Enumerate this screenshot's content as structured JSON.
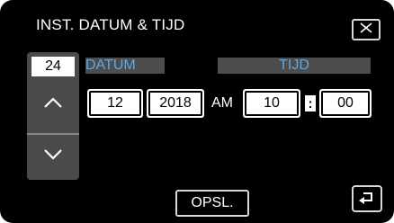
{
  "header": {
    "title": "INST. DATUM & TIJD"
  },
  "icons": {
    "close": "close-icon",
    "up": "chevron-up-icon",
    "down": "chevron-down-icon",
    "back": "return-icon"
  },
  "date": {
    "label": "DATUM",
    "day": "24",
    "month": "12",
    "year": "2018"
  },
  "time": {
    "label": "TIJD",
    "ampm": "AM",
    "hour": "10",
    "separator": ":",
    "minute": "00"
  },
  "footer": {
    "save_label": "OPSL."
  },
  "colors": {
    "background": "#000000",
    "accent": "#5ba9e8",
    "panel": "#4a4a4a"
  }
}
